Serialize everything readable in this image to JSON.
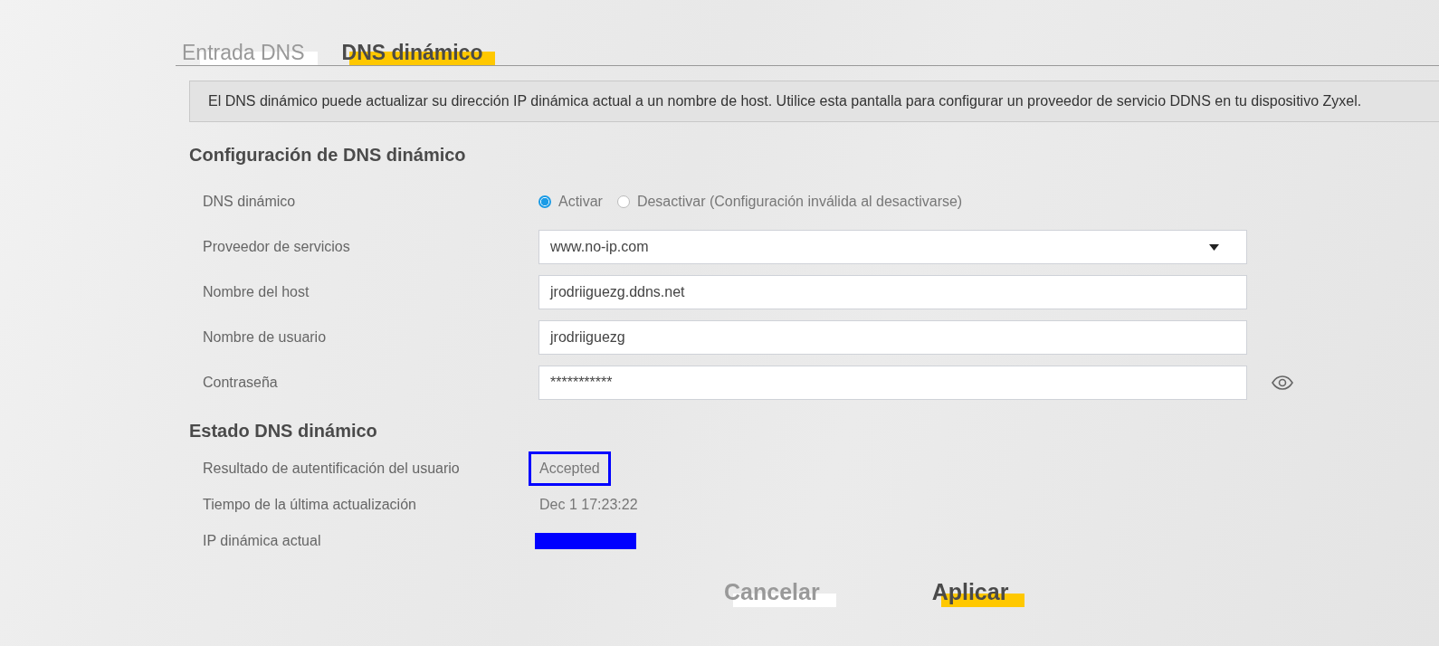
{
  "tabs": [
    {
      "label": "Entrada DNS",
      "selected": false
    },
    {
      "label": "DNS dinámico",
      "selected": true
    }
  ],
  "info": "El DNS dinámico puede actualizar su dirección IP dinámica actual a un nombre de host. Utilice esta pantalla para configurar un proveedor de servicio DDNS en tu dispositivo Zyxel.",
  "config": {
    "title": "Configuración de DNS dinámico",
    "rows": [
      {
        "kind": "radio",
        "label": "DNS dinámico",
        "options": [
          {
            "label": "Activar",
            "selected": true
          },
          {
            "label": "Desactivar (Configuración inválida al desactivarse)",
            "selected": false
          }
        ]
      },
      {
        "kind": "select",
        "label": "Proveedor de servicios",
        "value": "www.no-ip.com"
      },
      {
        "kind": "text",
        "label": "Nombre del host",
        "value": "jrodriiguezg.ddns.net"
      },
      {
        "kind": "text",
        "label": "Nombre de usuario",
        "value": "jrodriiguezg"
      },
      {
        "kind": "password",
        "label": "Contraseña",
        "value": "***********"
      }
    ]
  },
  "status": {
    "title": "Estado DNS dinámico",
    "rows": [
      {
        "kind": "text",
        "label": "Resultado de autentificación del usuario",
        "value": "Accepted",
        "highlighted": true
      },
      {
        "kind": "text",
        "label": "Tiempo de la última actualización",
        "value": "Dec 1 17:23:22",
        "highlighted": false
      },
      {
        "kind": "redacted",
        "label": "IP dinámica actual"
      }
    ]
  },
  "buttons": [
    {
      "label": "Cancelar",
      "kind": "secondary"
    },
    {
      "label": "Aplicar",
      "kind": "primary"
    }
  ]
}
